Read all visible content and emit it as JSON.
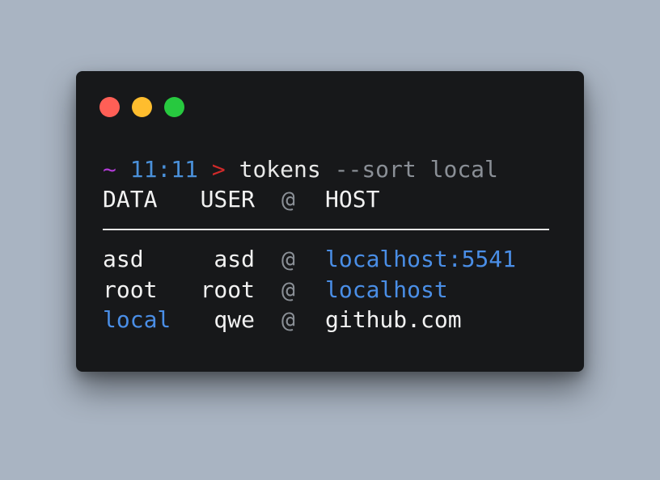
{
  "window": {
    "controls": {
      "close_color": "#ff5f56",
      "minimize_color": "#ffbd2e",
      "maximize_color": "#27c93f"
    }
  },
  "prompt": {
    "tilde": "~",
    "time": "11:11",
    "arrow": ">",
    "command": "tokens",
    "args": "--sort local"
  },
  "table": {
    "headers": {
      "data": "DATA",
      "user": "USER",
      "at": "@",
      "host": "HOST"
    },
    "rows": [
      {
        "data": "asd",
        "data_color": "white",
        "user": "asd",
        "at": "@",
        "host": "localhost:5541",
        "host_color": "blue"
      },
      {
        "data": "root",
        "data_color": "white",
        "user": "root",
        "at": "@",
        "host": "localhost",
        "host_color": "blue"
      },
      {
        "data": "local",
        "data_color": "blue",
        "user": "qwe",
        "at": "@",
        "host": "github.com",
        "host_color": "white"
      }
    ]
  },
  "colors": {
    "background": "#a9b4c2",
    "terminal": "#17181a",
    "blue": "#4a8ee6",
    "prompt_tilde": "#b13bd6",
    "prompt_time": "#4a90d9",
    "prompt_arrow": "#d02a2a"
  }
}
